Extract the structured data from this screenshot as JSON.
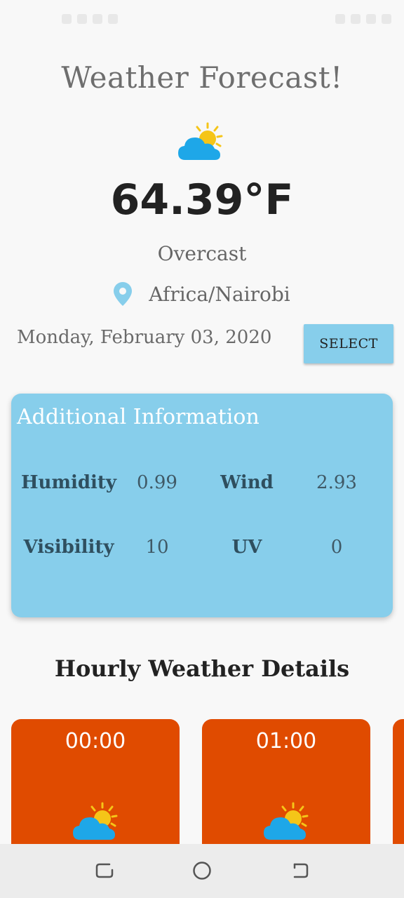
{
  "app": {
    "title": "Weather Forecast!",
    "temperature": "64.39°F",
    "condition": "Overcast",
    "location": "Africa/Nairobi",
    "date": "Monday, February 03, 2020",
    "select_button": "SELECT"
  },
  "additional_info": {
    "title": "Additional Information",
    "humidity_label": "Humidity",
    "humidity_value": "0.99",
    "wind_label": "Wind",
    "wind_value": "2.93",
    "visibility_label": "Visibility",
    "visibility_value": "10",
    "uv_label": "UV",
    "uv_value": "0"
  },
  "hourly": {
    "title": "Hourly Weather Details",
    "items": [
      {
        "time": "00:00",
        "icon": "partly-cloudy-icon"
      },
      {
        "time": "01:00",
        "icon": "partly-cloudy-icon"
      }
    ]
  },
  "colors": {
    "card_blue": "#87ceeb",
    "hour_card_orange": "#e04b00",
    "sun_yellow": "#f5c518",
    "cloud_blue": "#1ea7e8"
  }
}
